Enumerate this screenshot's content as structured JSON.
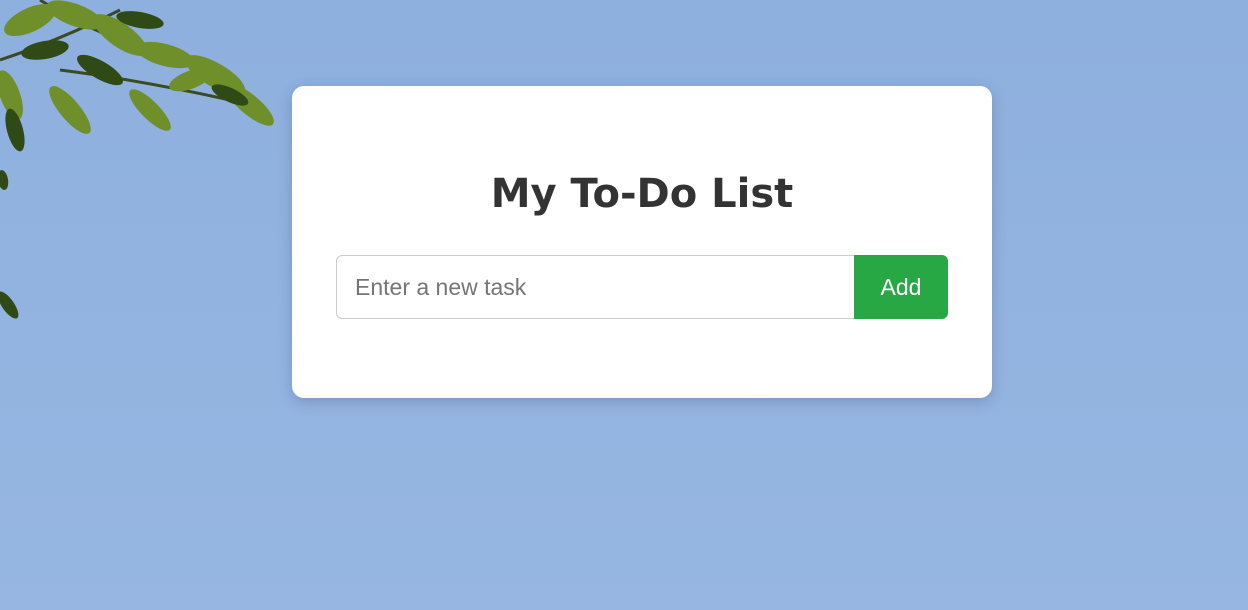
{
  "page": {
    "title": "My To-Do List"
  },
  "task_form": {
    "input_value": "",
    "input_placeholder": "Enter a new task",
    "add_label": "Add"
  },
  "colors": {
    "background_sky": "#93b3e0",
    "card": "#ffffff",
    "title_text": "#333333",
    "add_button": "#28a745",
    "add_button_text": "#ffffff",
    "input_border": "#cccccc"
  }
}
